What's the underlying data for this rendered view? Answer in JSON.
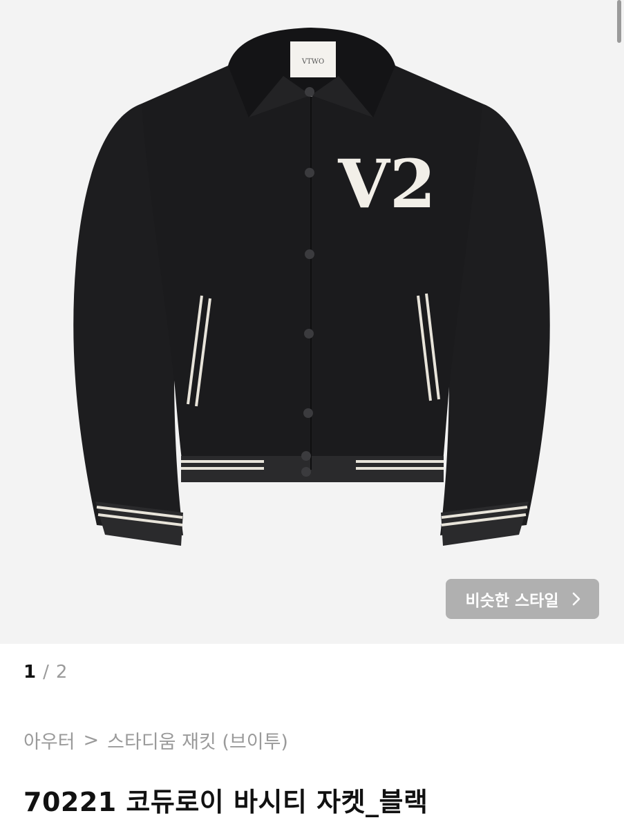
{
  "product_image": {
    "label_text": "VTWO",
    "chest_logo": "V2"
  },
  "similar_style_button": {
    "label": "비슷한 스타일",
    "icon": "chevron-right-icon"
  },
  "pager": {
    "current": "1",
    "separator": "/",
    "total": "2"
  },
  "breadcrumb": {
    "category": "아우터",
    "separator": ">",
    "subcategory": "스타디움 재킷 (브이투)"
  },
  "product": {
    "title": "70221 코듀로이 바시티 자켓_블랙"
  },
  "colors": {
    "image_background": "#f3f3f3",
    "jacket_body": "#1b1b1d",
    "stripe": "#e8e4da",
    "button_overlay": "#969696",
    "title_text": "#111111",
    "muted_text": "#9a9a9a"
  }
}
